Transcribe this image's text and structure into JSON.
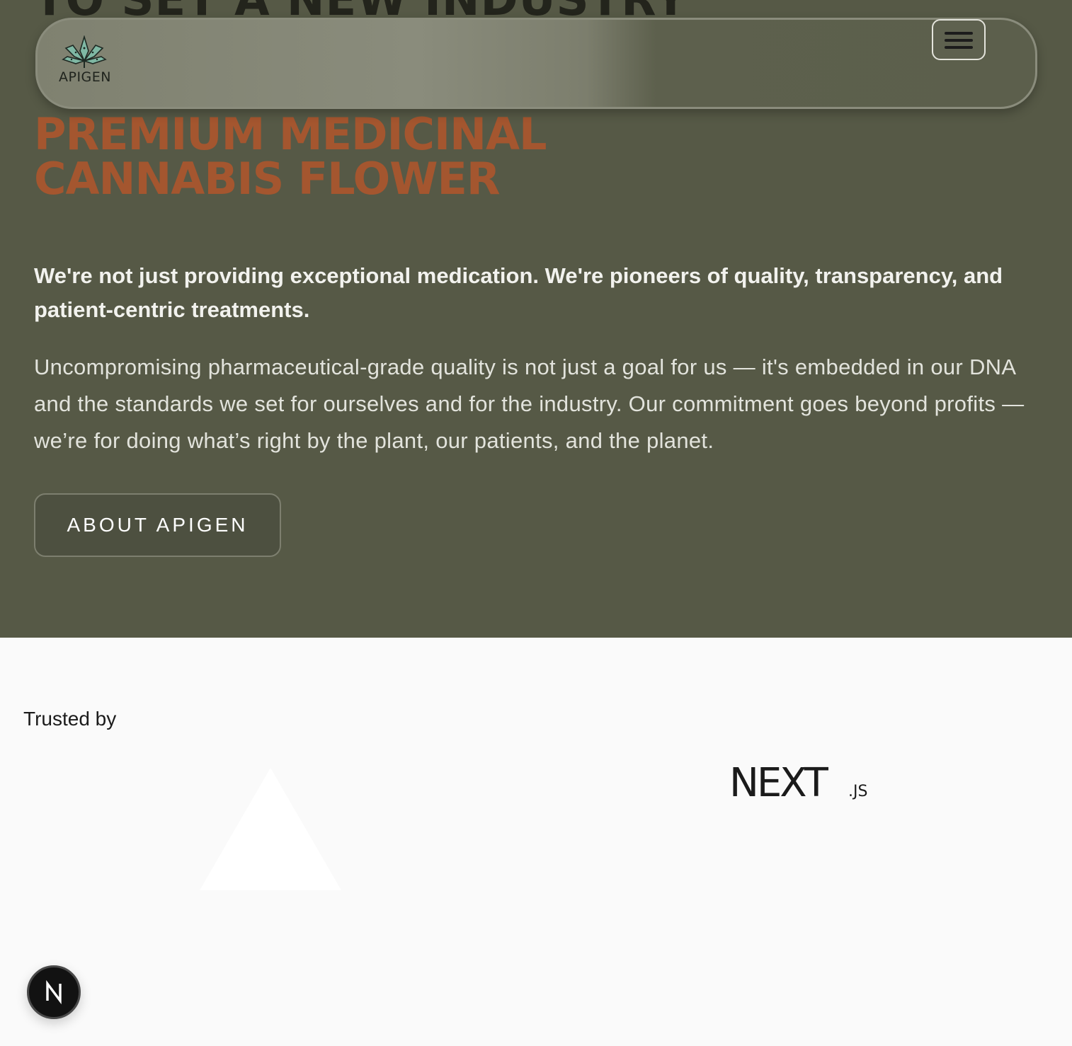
{
  "hero": {
    "cut_title": "TO SET A NEW INDUSTRY",
    "title_line1": "PREMIUM MEDICINAL",
    "title_line2": "CANNABIS FLOWER",
    "lead": "We're not just providing exceptional medication. We're pioneers of quality, transparency, and patient-centric treatments.",
    "body": "Uncompromising pharmaceutical-grade quality is not just a goal for us — it's embedded in our DNA and the standards we set for ourselves and for the industry. Our commitment goes beyond profits — we’re for doing what’s right by the plant, our patients, and the planet.",
    "button_label": "ABOUT APIGEN"
  },
  "navbar": {
    "logo_text": "APIGEN",
    "logo_icon": "cannabis-leaf-icon",
    "menu_icon": "hamburger-menu-icon"
  },
  "trusted": {
    "label": "Trusted by",
    "logos": [
      {
        "name": "vercel-triangle-logo",
        "color": "#ffffff"
      },
      {
        "name": "nextjs-logo",
        "text": "NEXT",
        "suffix": ".JS"
      }
    ]
  },
  "dev_badge": {
    "letter": "N",
    "icon": "nextjs-dev-indicator-icon"
  },
  "colors": {
    "hero_background": "#565946",
    "accent_orange": "#a4562f",
    "page_background": "#fafafa"
  }
}
